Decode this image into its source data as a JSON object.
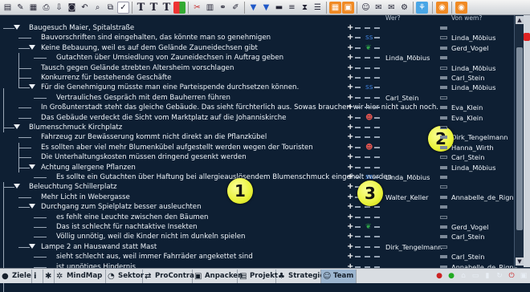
{
  "columns": {
    "who_header": "Wer?",
    "from_header": "Von wem?"
  },
  "rows": [
    {
      "text": "Baugesuch Maier, Spitalstraße",
      "level": 0,
      "toggle": true,
      "who": "",
      "from": "",
      "icon": ""
    },
    {
      "text": "Bauvorschriften sind eingehalten, das könnte man so genehmigen",
      "level": 1,
      "toggle": false,
      "who": "",
      "from": "Linda_Möbius",
      "icon": "note"
    },
    {
      "text": "Keine Bebauung, weil es auf dem Gelände Zauneidechsen gibt",
      "level": 1,
      "toggle": true,
      "who": "",
      "from": "Gerd_Vogel",
      "icon": "plant"
    },
    {
      "text": "Gutachten über Umsiedlung von Zauneidechsen in Auftrag geben",
      "level": 2,
      "toggle": false,
      "who": "Linda_Möbius",
      "from": "",
      "icon": ""
    },
    {
      "text": "Tausch gegen Gelände strebten Altersheim vorschlagen",
      "level": 1,
      "toggle": false,
      "who": "",
      "from": "Linda_Möbius",
      "icon": ""
    },
    {
      "text": "Konkurrenz für bestehende Geschäfte",
      "level": 1,
      "toggle": false,
      "who": "",
      "from": "Carl_Stein",
      "icon": ""
    },
    {
      "text": "Für die Genehmigung müsste man eine Parteispende durchsetzen können.",
      "level": 1,
      "toggle": true,
      "who": "",
      "from": "Linda_Möbius",
      "icon": "note"
    },
    {
      "text": "Vertrauliches Gespräch mit dem Bauherren führen",
      "level": 2,
      "toggle": false,
      "who": "Carl_Stein",
      "from": "",
      "icon": ""
    },
    {
      "text": "In Großunterstadt steht das gleiche Gebäude. Das sieht fürchterlich aus. Sowas brauchen wir hier nicht auch noch.",
      "level": 1,
      "toggle": false,
      "who": "",
      "from": "Eva_Klein",
      "icon": ""
    },
    {
      "text": "Das Gebäude verdeckt die Sicht vom Marktplatz auf die Johanniskirche",
      "level": 1,
      "toggle": false,
      "who": "",
      "from": "Eva_Klein",
      "icon": "person"
    },
    {
      "text": "Blumenschmuck Kirchplatz",
      "level": 0,
      "toggle": true,
      "who": "",
      "from": "",
      "icon": ""
    },
    {
      "text": "Fahrzeug zur Bewässerung kommt nicht direkt an die Pflanzkübel",
      "level": 1,
      "toggle": false,
      "who": "",
      "from": "Dirk_Tengelmann",
      "icon": ""
    },
    {
      "text": "Es sollten aber viel mehr Blumenkübel aufgestellt werden wegen der Touristen",
      "level": 1,
      "toggle": false,
      "who": "",
      "from": "Hanna_Wirth",
      "icon": "person"
    },
    {
      "text": "Die Unterhaltungskosten müssen dringend gesenkt werden",
      "level": 1,
      "toggle": false,
      "who": "",
      "from": "Carl_Stein",
      "icon": ""
    },
    {
      "text": "Achtung allergene Pflanzen",
      "level": 1,
      "toggle": true,
      "who": "",
      "from": "Linda_Möbius",
      "icon": ""
    },
    {
      "text": "Es sollte ein Gutachten über Haftung bei allergieauslösendem Blumenschmuck eingeholt werden",
      "level": 2,
      "toggle": false,
      "who": "Linda_Möbius",
      "from": "",
      "icon": "note"
    },
    {
      "text": "Beleuchtung Schillerplatz",
      "level": 0,
      "toggle": true,
      "who": "",
      "from": "",
      "icon": ""
    },
    {
      "text": "Mehr Licht in Webergasse",
      "level": 1,
      "toggle": false,
      "who": "Walter_Keller",
      "from": "Annabelle_de_Rigny",
      "icon": ""
    },
    {
      "text": "Durchgang zum Spielplatz besser ausleuchten",
      "level": 1,
      "toggle": true,
      "who": "",
      "from": "",
      "icon": ""
    },
    {
      "text": "es fehlt eine Leuchte zwischen den Bäumen",
      "level": 2,
      "toggle": false,
      "who": "",
      "from": "",
      "icon": ""
    },
    {
      "text": "Das ist schlecht für nachtaktive Insekten",
      "level": 2,
      "toggle": false,
      "who": "",
      "from": "Gerd_Vogel",
      "icon": "plant"
    },
    {
      "text": "Völlig unnötig, weil die Kinder nicht im dunkeln spielen",
      "level": 2,
      "toggle": false,
      "who": "",
      "from": "Carl_Stein",
      "icon": ""
    },
    {
      "text": "Lampe 2 an Hauswand statt Mast",
      "level": 1,
      "toggle": true,
      "who": "Dirk_Tengelmann",
      "from": "",
      "icon": ""
    },
    {
      "text": "sieht schlecht aus, weil immer Fahrräder angekettet sind",
      "level": 2,
      "toggle": false,
      "who": "",
      "from": "Carl_Stein",
      "icon": ""
    },
    {
      "text": "ist unnötiges Hindernis",
      "level": 2,
      "toggle": false,
      "who": "",
      "from": "Annabelle_de_Rigny",
      "icon": ""
    }
  ],
  "callouts": [
    "1",
    "2",
    "3"
  ],
  "tabs": [
    {
      "label": "Ziele",
      "icon": "ziele-icon",
      "glyph": "●"
    },
    {
      "label": "",
      "icon": "info-icon",
      "glyph": "i"
    },
    {
      "label": "",
      "icon": "asterisk-icon",
      "glyph": "✱"
    },
    {
      "label": "MindMap",
      "icon": "mindmap-icon",
      "glyph": "✲"
    },
    {
      "label": "Sektor",
      "icon": "sektor-icon",
      "glyph": "◔"
    },
    {
      "label": "ProContra",
      "icon": "procontra-icon",
      "glyph": "⇄"
    },
    {
      "label": "Anpacken",
      "icon": "anpacken-icon",
      "glyph": "▣"
    },
    {
      "label": "Projekt",
      "icon": "projekt-icon",
      "glyph": "▤"
    },
    {
      "label": "Strategie",
      "icon": "strategie-icon",
      "glyph": "♣"
    },
    {
      "label": "Team",
      "icon": "team-icon",
      "glyph": "☺"
    }
  ],
  "colors": {
    "background": "#0e1f33",
    "active_tab": "#9db6d0",
    "callout": "#e9f23a"
  }
}
